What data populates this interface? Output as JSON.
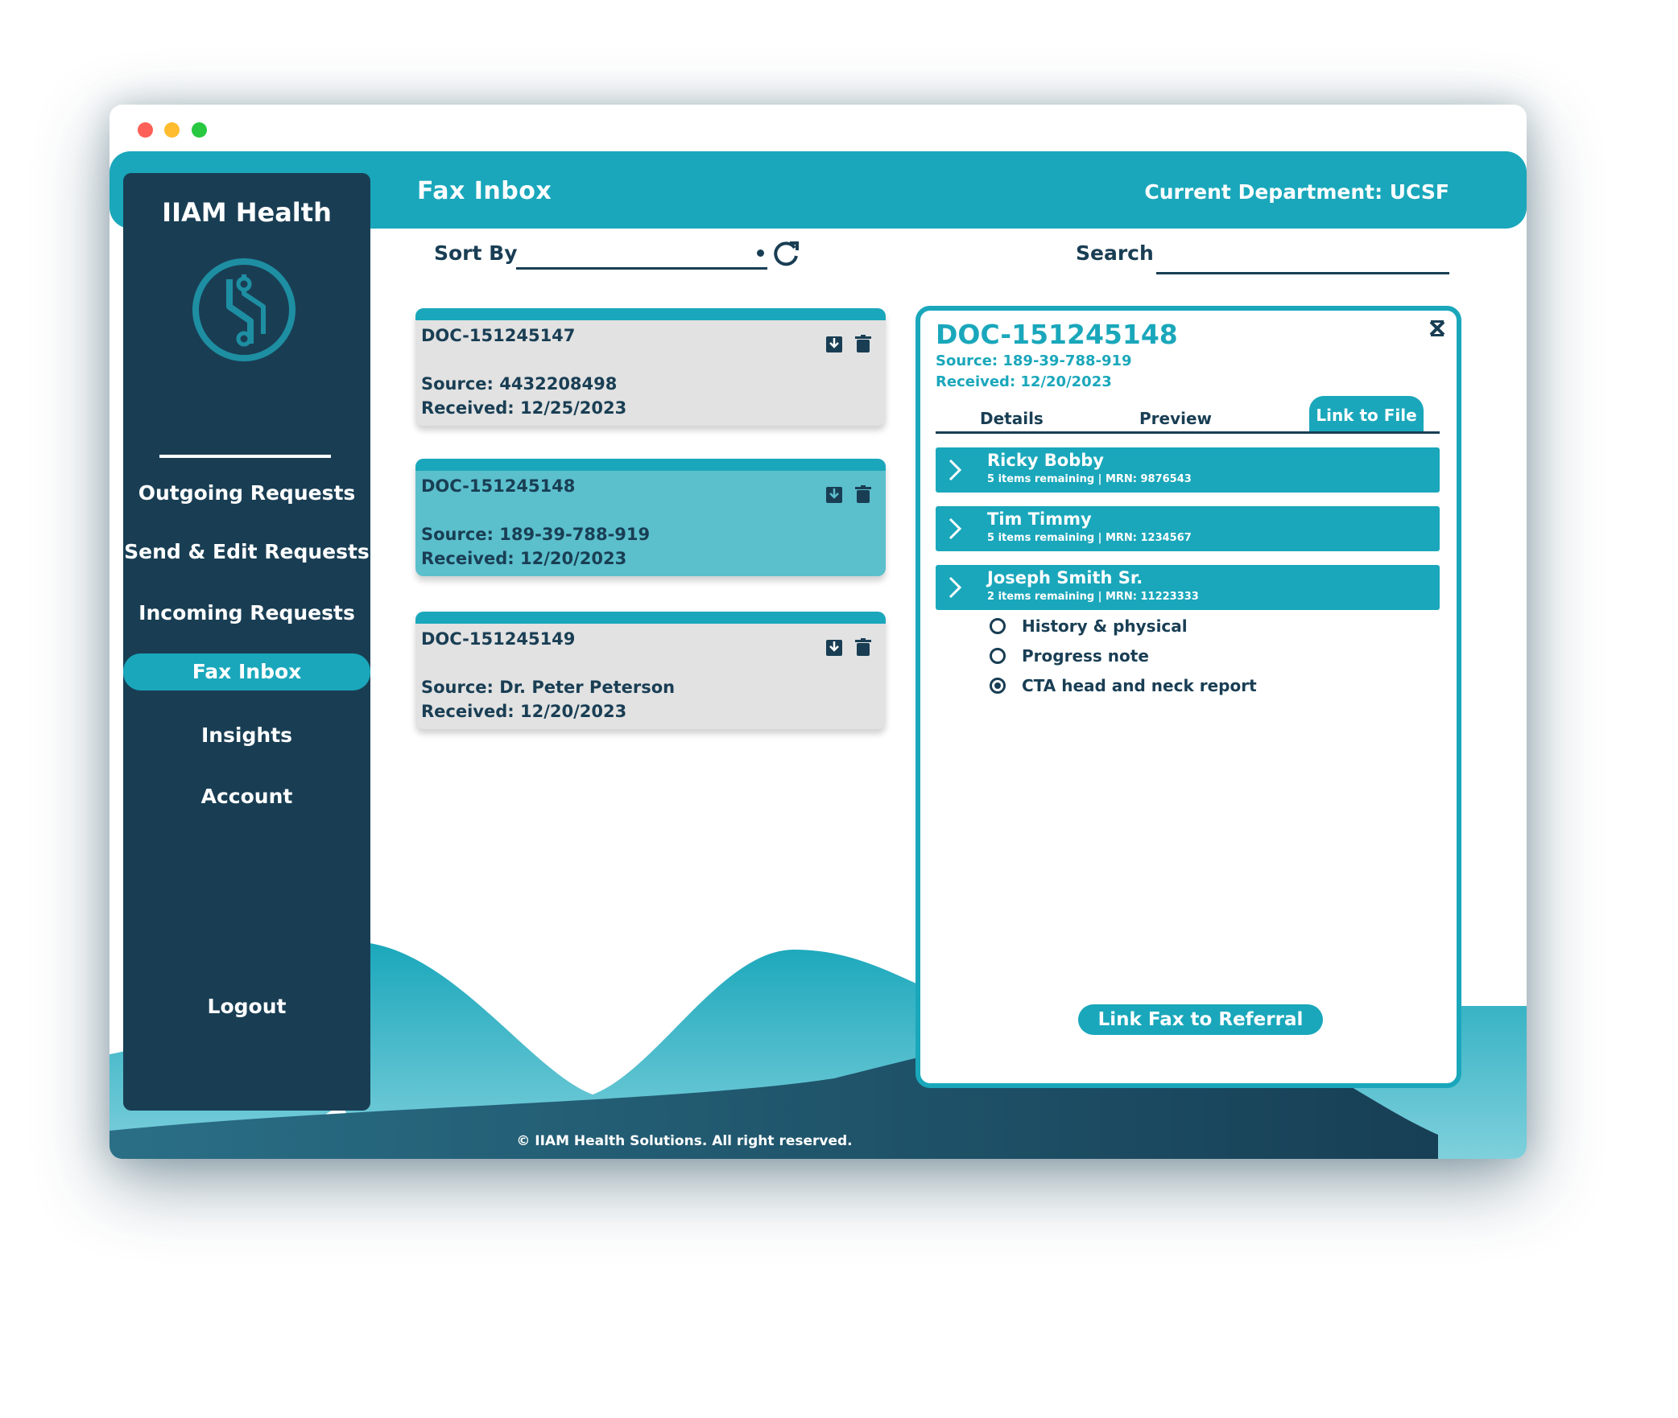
{
  "window": {
    "controls": [
      "close",
      "minimize",
      "maximize"
    ]
  },
  "brand": "IIAM Health",
  "header": {
    "title": "Fax Inbox",
    "department": "Current Department: UCSF"
  },
  "sidebar": {
    "items": [
      {
        "label": "Outgoing Requests"
      },
      {
        "label": "Send & Edit Requests"
      },
      {
        "label": "Incoming Requests"
      },
      {
        "label": "Fax Inbox",
        "active": true
      },
      {
        "label": "Insights"
      },
      {
        "label": "Account"
      }
    ],
    "logout": "Logout"
  },
  "toolbar": {
    "sort_label": "Sort By",
    "search_label": "Search",
    "sort_value": "",
    "search_value": ""
  },
  "faxes": [
    {
      "id": "DOC-151245147",
      "source_label": "Source:",
      "source": "4432208498",
      "received_label": "Received:",
      "received": "12/25/2023",
      "selected": false
    },
    {
      "id": "DOC-151245148",
      "source_label": "Source:",
      "source": "189-39-788-919",
      "received_label": "Received:",
      "received": "12/20/2023",
      "selected": true
    },
    {
      "id": "DOC-151245149",
      "source_label": "Source:",
      "source": "Dr. Peter Peterson",
      "received_label": "Received:",
      "received": "12/20/2023",
      "selected": false
    }
  ],
  "detail": {
    "title": "DOC-151245148",
    "source": "Source: 189-39-788-919",
    "received": "Received: 12/20/2023",
    "tabs": [
      "Details",
      "Preview"
    ],
    "link_file": "Link to File",
    "patients": [
      {
        "name": "Ricky Bobby",
        "meta": "5 items remaining | MRN: 9876543"
      },
      {
        "name": "Tim Timmy",
        "meta": "5 items remaining | MRN: 1234567"
      },
      {
        "name": "Joseph Smith Sr.",
        "meta": "2 items remaining | MRN: 11223333"
      }
    ],
    "documents": [
      {
        "label": "History & physical",
        "checked": false
      },
      {
        "label": "Progress note",
        "checked": false
      },
      {
        "label": "CTA head and neck report",
        "checked": true
      }
    ],
    "link_referral": "Link Fax to Referral"
  },
  "footer": "© IIAM Health Solutions. All right reserved.",
  "colors": {
    "accent": "#1aa7bb",
    "navy": "#193e54",
    "card": "#e2e2e2",
    "card_selected": "#5bbfcc"
  },
  "icons": [
    "refresh-icon",
    "download-icon",
    "trash-icon",
    "close-icon",
    "chevron-right-icon",
    "circuit-logo-icon"
  ]
}
